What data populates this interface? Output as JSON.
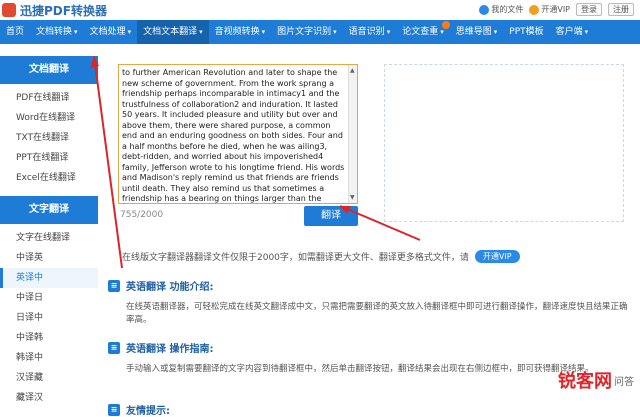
{
  "header": {
    "app_title": "迅捷PDF转换器",
    "my_files": "我的文件",
    "vip": "开通VIP",
    "login": "登录",
    "register": "注册"
  },
  "nav": [
    {
      "label": "首页"
    },
    {
      "label": "文档转换",
      "caret": "▾"
    },
    {
      "label": "文档处理",
      "caret": "▾"
    },
    {
      "label": "文档文本翻译",
      "caret": "▾"
    },
    {
      "label": "音视频转换",
      "caret": "▾"
    },
    {
      "label": "图片文字识别",
      "caret": "▾"
    },
    {
      "label": "语音识别",
      "caret": "▾"
    },
    {
      "label": "论文查重",
      "caret": "▾"
    },
    {
      "label": "思维导图",
      "caret": "▾"
    },
    {
      "label": "PPT模板"
    },
    {
      "label": "客户端",
      "caret": "▾"
    }
  ],
  "sidebar": {
    "section1_title": "文档翻译",
    "section1_items": [
      "PDF在线翻译",
      "Word在线翻译",
      "TXT在线翻译",
      "PPT在线翻译",
      "Excel在线翻译"
    ],
    "section2_title": "文字翻译",
    "section2_items": [
      "文字在线翻译",
      "中译英",
      "英译中",
      "中译日",
      "日译中",
      "中译韩",
      "韩译中",
      "汉译藏",
      "藏译汉"
    ]
  },
  "translator": {
    "source_text": "to further American Revolution and later to shape the new scheme of government. From the work sprang a friendship perhaps incomparable in intimacy1 and the trustfulness of collaboration2 and induration. It lasted 50 years. It included pleasure and utility but over and above them, there were shared purpose, a common end and an enduring goodness on both sides. Four and a half months before he died, when he was ailing3, debt-ridden, and worried about his impoverished4 family, Jefferson wrote to his longtime friend. His words and Madison's reply remind us that friends are friends until death. They also remind us that sometimes a friendship has a bearing on things larger than the friendship itself, for has there ever been a friendship of greater public consequence than this one?",
    "counter": "755/2000",
    "translate_button": "翻译",
    "notice": "在线版文字翻译器翻译文件仅限于2000字，如需翻译更大文件、翻译更多格式文件，请",
    "vip_button": "开通VIP"
  },
  "intro": {
    "title": "英语翻译 功能介绍:",
    "body": "在线英语翻译器，可轻松完成在线英文翻译成中文，只需把需要翻译的英文放入待翻译框中即可进行翻译操作，翻译速度快且结果正确率高。"
  },
  "guide": {
    "title": "英语翻译 操作指南:",
    "body": "手动输入或复制需要翻译的文字内容到待翻译框中，然后单击翻译按钮，翻译结果会出现在右侧边框中，即可获得翻译结果。"
  },
  "tips": {
    "title": "友情提示:"
  },
  "watermark": {
    "brand": "锐客网",
    "sub": "问答"
  },
  "colors": {
    "primary": "#1f7cd6",
    "accent_border": "#e0a74c",
    "arrow": "#d9262b"
  }
}
